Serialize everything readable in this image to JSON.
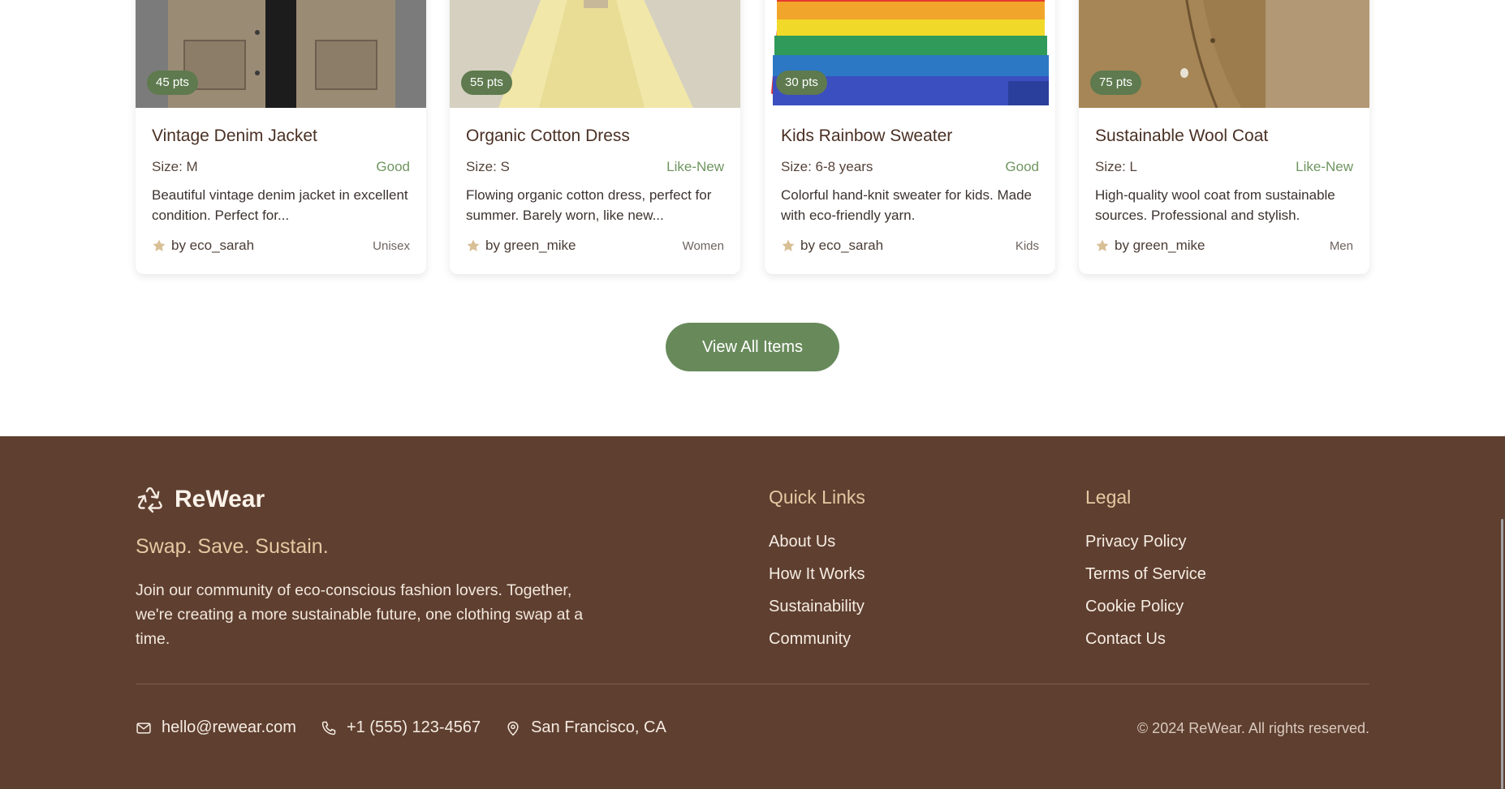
{
  "items": [
    {
      "title": "Vintage Denim Jacket",
      "points": "45 pts",
      "size": "Size: M",
      "condition": "Good",
      "description": "Beautiful vintage denim jacket in excellent condition. Perfect for...",
      "user": "by eco_sarah",
      "category": "Unisex"
    },
    {
      "title": "Organic Cotton Dress",
      "points": "55 pts",
      "size": "Size: S",
      "condition": "Like-New",
      "description": "Flowing organic cotton dress, perfect for summer. Barely worn, like new...",
      "user": "by green_mike",
      "category": "Women"
    },
    {
      "title": "Kids Rainbow Sweater",
      "points": "30 pts",
      "size": "Size: 6-8 years",
      "condition": "Good",
      "description": "Colorful hand-knit sweater for kids. Made with eco-friendly yarn.",
      "user": "by eco_sarah",
      "category": "Kids"
    },
    {
      "title": "Sustainable Wool Coat",
      "points": "75 pts",
      "size": "Size: L",
      "condition": "Like-New",
      "description": "High-quality wool coat from sustainable sources. Professional and stylish.",
      "user": "by green_mike",
      "category": "Men"
    }
  ],
  "view_all_label": "View All Items",
  "footer": {
    "brand": "ReWear",
    "tagline": "Swap. Save. Sustain.",
    "about": "Join our community of eco-conscious fashion lovers. Together, we're creating a more sustainable future, one clothing swap at a time.",
    "quick_links": {
      "title": "Quick Links",
      "items": [
        "About Us",
        "How It Works",
        "Sustainability",
        "Community"
      ]
    },
    "legal": {
      "title": "Legal",
      "items": [
        "Privacy Policy",
        "Terms of Service",
        "Cookie Policy",
        "Contact Us"
      ]
    },
    "email": "hello@rewear.com",
    "phone": "+1 (555) 123-4567",
    "location": "San Francisco, CA",
    "copyright": "© 2024 ReWear. All rights reserved."
  },
  "colors": {
    "accent_green": "#688a5b",
    "footer_brown": "#5f3f30",
    "footer_gold": "#e6c8a2"
  }
}
